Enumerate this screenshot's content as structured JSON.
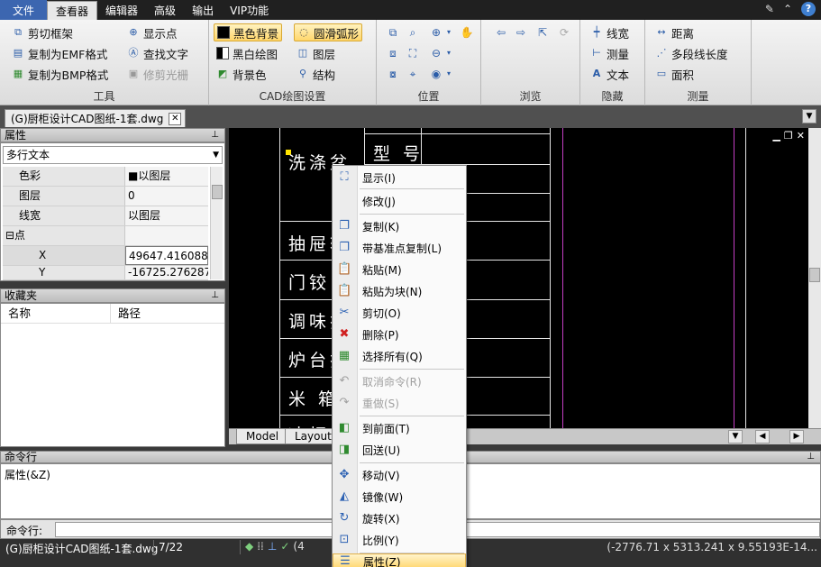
{
  "menu": {
    "items": [
      "文件",
      "查看器",
      "编辑器",
      "高级",
      "输出",
      "VIP功能"
    ],
    "active": "查看器"
  },
  "ribbon": {
    "tools": {
      "label": "工具",
      "buttons": [
        "剪切框架",
        "复制为EMF格式",
        "复制为BMP格式",
        "显示点",
        "查找文字",
        "修剪光栅"
      ]
    },
    "cad": {
      "label": "CAD绘图设置",
      "buttons": [
        "黑色背景",
        "黑白绘图",
        "背景色",
        "圆滑弧形",
        "图层",
        "结构"
      ]
    },
    "position": {
      "label": "位置"
    },
    "browse": {
      "label": "浏览"
    },
    "hide": {
      "label": "隐藏",
      "buttons": [
        "线宽",
        "测量",
        "文本"
      ]
    },
    "measure": {
      "label": "测量",
      "buttons": [
        "距离",
        "多段线长度",
        "面积"
      ]
    }
  },
  "document": {
    "tab_title": "(G)厨柜设计CAD图纸-1套.dwg"
  },
  "properties": {
    "title": "属性",
    "selected_type": "多行文本",
    "rows": [
      {
        "name": "色彩",
        "value": "■以图层"
      },
      {
        "name": "图层",
        "value": "0"
      },
      {
        "name": "线宽",
        "value": "以图层"
      },
      {
        "name": "⊟点",
        "value": ""
      },
      {
        "name": "X",
        "value": "49647.41608859"
      },
      {
        "name": "Y",
        "value": "-16725.27628704"
      }
    ]
  },
  "favorites": {
    "title": "收藏夹",
    "col_name": "名称",
    "col_path": "路径"
  },
  "drawing": {
    "texts": [
      "洗涤盆",
      "型 号",
      "抽屉轨",
      "门铰",
      "调味拉",
      "炉台拉",
      "米 箱",
      "冰柜"
    ],
    "layout_tabs": [
      "Model",
      "Layout1"
    ]
  },
  "command": {
    "title": "命令行",
    "output": "属性(&Z)",
    "input_label": "命令行:"
  },
  "status": {
    "file": "(G)厨柜设计CAD图纸-1套.dwg",
    "page": "7/22",
    "coords": "(-2776.71 x 5313.241 x 9.55193E-14...",
    "partial": "(4"
  },
  "context_menu": {
    "items": [
      {
        "label": "显示(I)",
        "icon": "fit-icon",
        "glyph": "⛶"
      },
      {
        "label": "修改(J)",
        "icon": "none",
        "glyph": ""
      },
      {
        "label": "复制(K)",
        "icon": "copy-icon",
        "glyph": "❐"
      },
      {
        "label": "带基准点复制(L)",
        "icon": "copy-base-icon",
        "glyph": "❐"
      },
      {
        "label": "粘贴(M)",
        "icon": "paste-icon",
        "glyph": "📋"
      },
      {
        "label": "粘贴为块(N)",
        "icon": "paste-block-icon",
        "glyph": "📋"
      },
      {
        "label": "剪切(O)",
        "icon": "scissors-icon",
        "glyph": "✂"
      },
      {
        "label": "删除(P)",
        "icon": "delete-icon",
        "glyph": "✖"
      },
      {
        "label": "选择所有(Q)",
        "icon": "select-all-icon",
        "glyph": "▦"
      },
      {
        "label": "取消命令(R)",
        "icon": "undo-icon",
        "glyph": "↶"
      },
      {
        "label": "重做(S)",
        "icon": "redo-icon",
        "glyph": "↷"
      },
      {
        "label": "到前面(T)",
        "icon": "bring-front-icon",
        "glyph": "◧"
      },
      {
        "label": "回送(U)",
        "icon": "send-back-icon",
        "glyph": "◨"
      },
      {
        "label": "移动(V)",
        "icon": "move-icon",
        "glyph": "✥"
      },
      {
        "label": "镜像(W)",
        "icon": "mirror-icon",
        "glyph": "◭"
      },
      {
        "label": "旋转(X)",
        "icon": "rotate-icon",
        "glyph": "↻"
      },
      {
        "label": "比例(Y)",
        "icon": "scale-icon",
        "glyph": "⊡"
      },
      {
        "label": "属性(Z)",
        "icon": "properties-icon",
        "glyph": "☰"
      }
    ]
  },
  "colors": {
    "menubar": "#202020",
    "file_tab": "#3c66b0",
    "canvas": "#000000",
    "magenta_line": "#c43fc4",
    "highlight": "#ffd978"
  }
}
